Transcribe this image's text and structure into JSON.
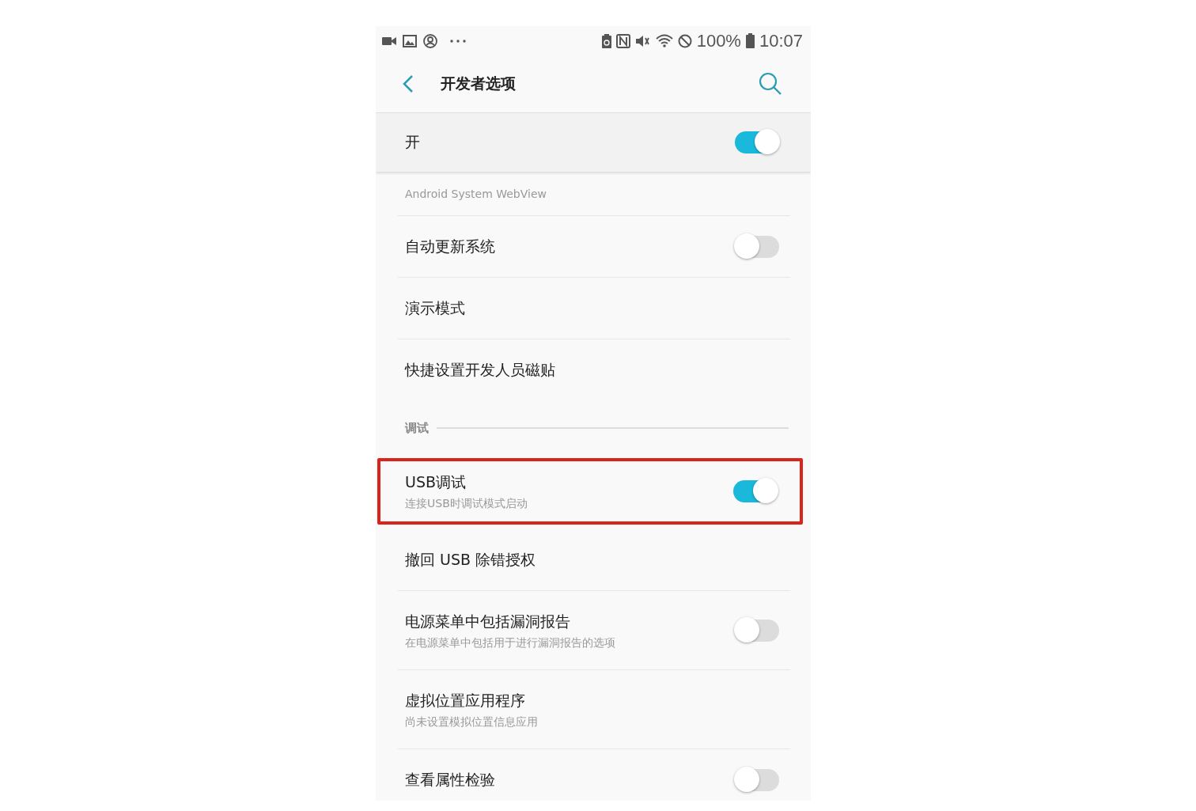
{
  "status_bar": {
    "battery_percent": "100%",
    "time": "10:07"
  },
  "header": {
    "title": "开发者选项"
  },
  "master_switch": {
    "label": "开",
    "on": true
  },
  "rows": [
    {
      "kind": "subtitle_only",
      "subtitle": "Android System WebView"
    },
    {
      "kind": "toggle",
      "title": "自动更新系统",
      "on": false
    },
    {
      "kind": "plain",
      "title": "演示模式"
    },
    {
      "kind": "plain",
      "title": "快捷设置开发人员磁贴"
    },
    {
      "kind": "section",
      "title": "调试"
    },
    {
      "kind": "toggle",
      "title": "USB调试",
      "subtitle": "连接USB时调试模式启动",
      "on": true,
      "highlighted": true
    },
    {
      "kind": "plain",
      "title": "撤回 USB 除错授权"
    },
    {
      "kind": "toggle",
      "title": "电源菜单中包括漏洞报告",
      "subtitle": "在电源菜单中包括用于进行漏洞报告的选项",
      "on": false
    },
    {
      "kind": "plain",
      "title": "虚拟位置应用程序",
      "subtitle": "尚未设置模拟位置信息应用"
    },
    {
      "kind": "toggle",
      "title": "查看属性检验",
      "on": false
    }
  ]
}
